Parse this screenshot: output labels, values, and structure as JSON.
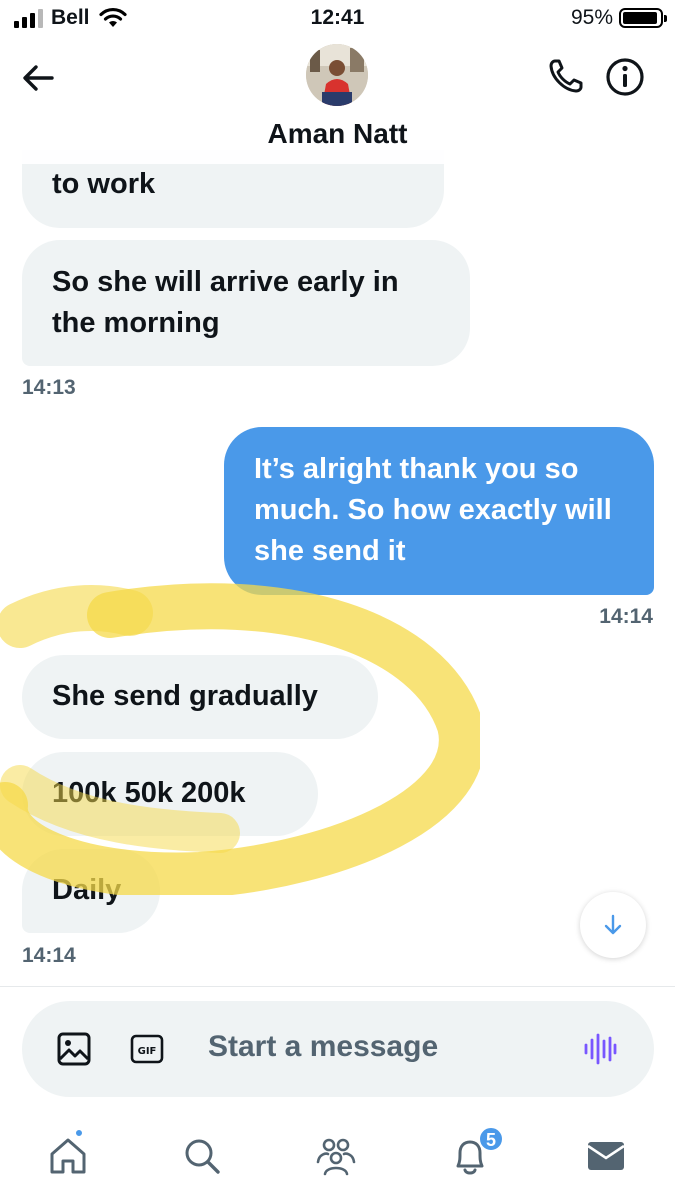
{
  "status_bar": {
    "carrier": "Bell",
    "time": "12:41",
    "battery": "95%",
    "battery_level": 0.95
  },
  "header": {
    "contact_name": "Aman Natt",
    "back_icon": "arrow-left-icon",
    "call_icon": "phone-icon",
    "info_icon": "info-icon"
  },
  "messages": [
    {
      "direction": "incoming",
      "text": "to work"
    },
    {
      "direction": "incoming",
      "text": "So she will arrive early in the morning"
    },
    {
      "type": "timestamp",
      "text": "14:13"
    },
    {
      "direction": "outgoing",
      "text": "It’s alright thank you so much. So how exactly will she send it"
    },
    {
      "type": "timestamp",
      "text": "14:14"
    },
    {
      "direction": "incoming",
      "text": "She send gradually"
    },
    {
      "direction": "incoming",
      "text": "100k 50k 200k"
    },
    {
      "direction": "incoming",
      "text": "Daily"
    },
    {
      "type": "timestamp",
      "text": "14:14"
    }
  ],
  "composer": {
    "placeholder": "Start a message",
    "image_icon": "image-icon",
    "gif_icon": "gif-icon",
    "voice_icon": "voice-wave-icon"
  },
  "tab_bar": {
    "items": [
      {
        "icon": "home-icon",
        "has_dot": true
      },
      {
        "icon": "search-icon"
      },
      {
        "icon": "communities-icon"
      },
      {
        "icon": "bell-icon",
        "badge": "5"
      },
      {
        "icon": "mail-icon"
      }
    ]
  },
  "colors": {
    "accent": "#4a99e9",
    "incoming_bubble": "#eff3f4",
    "secondary_text": "#536471",
    "highlight": "#f5d94a"
  }
}
